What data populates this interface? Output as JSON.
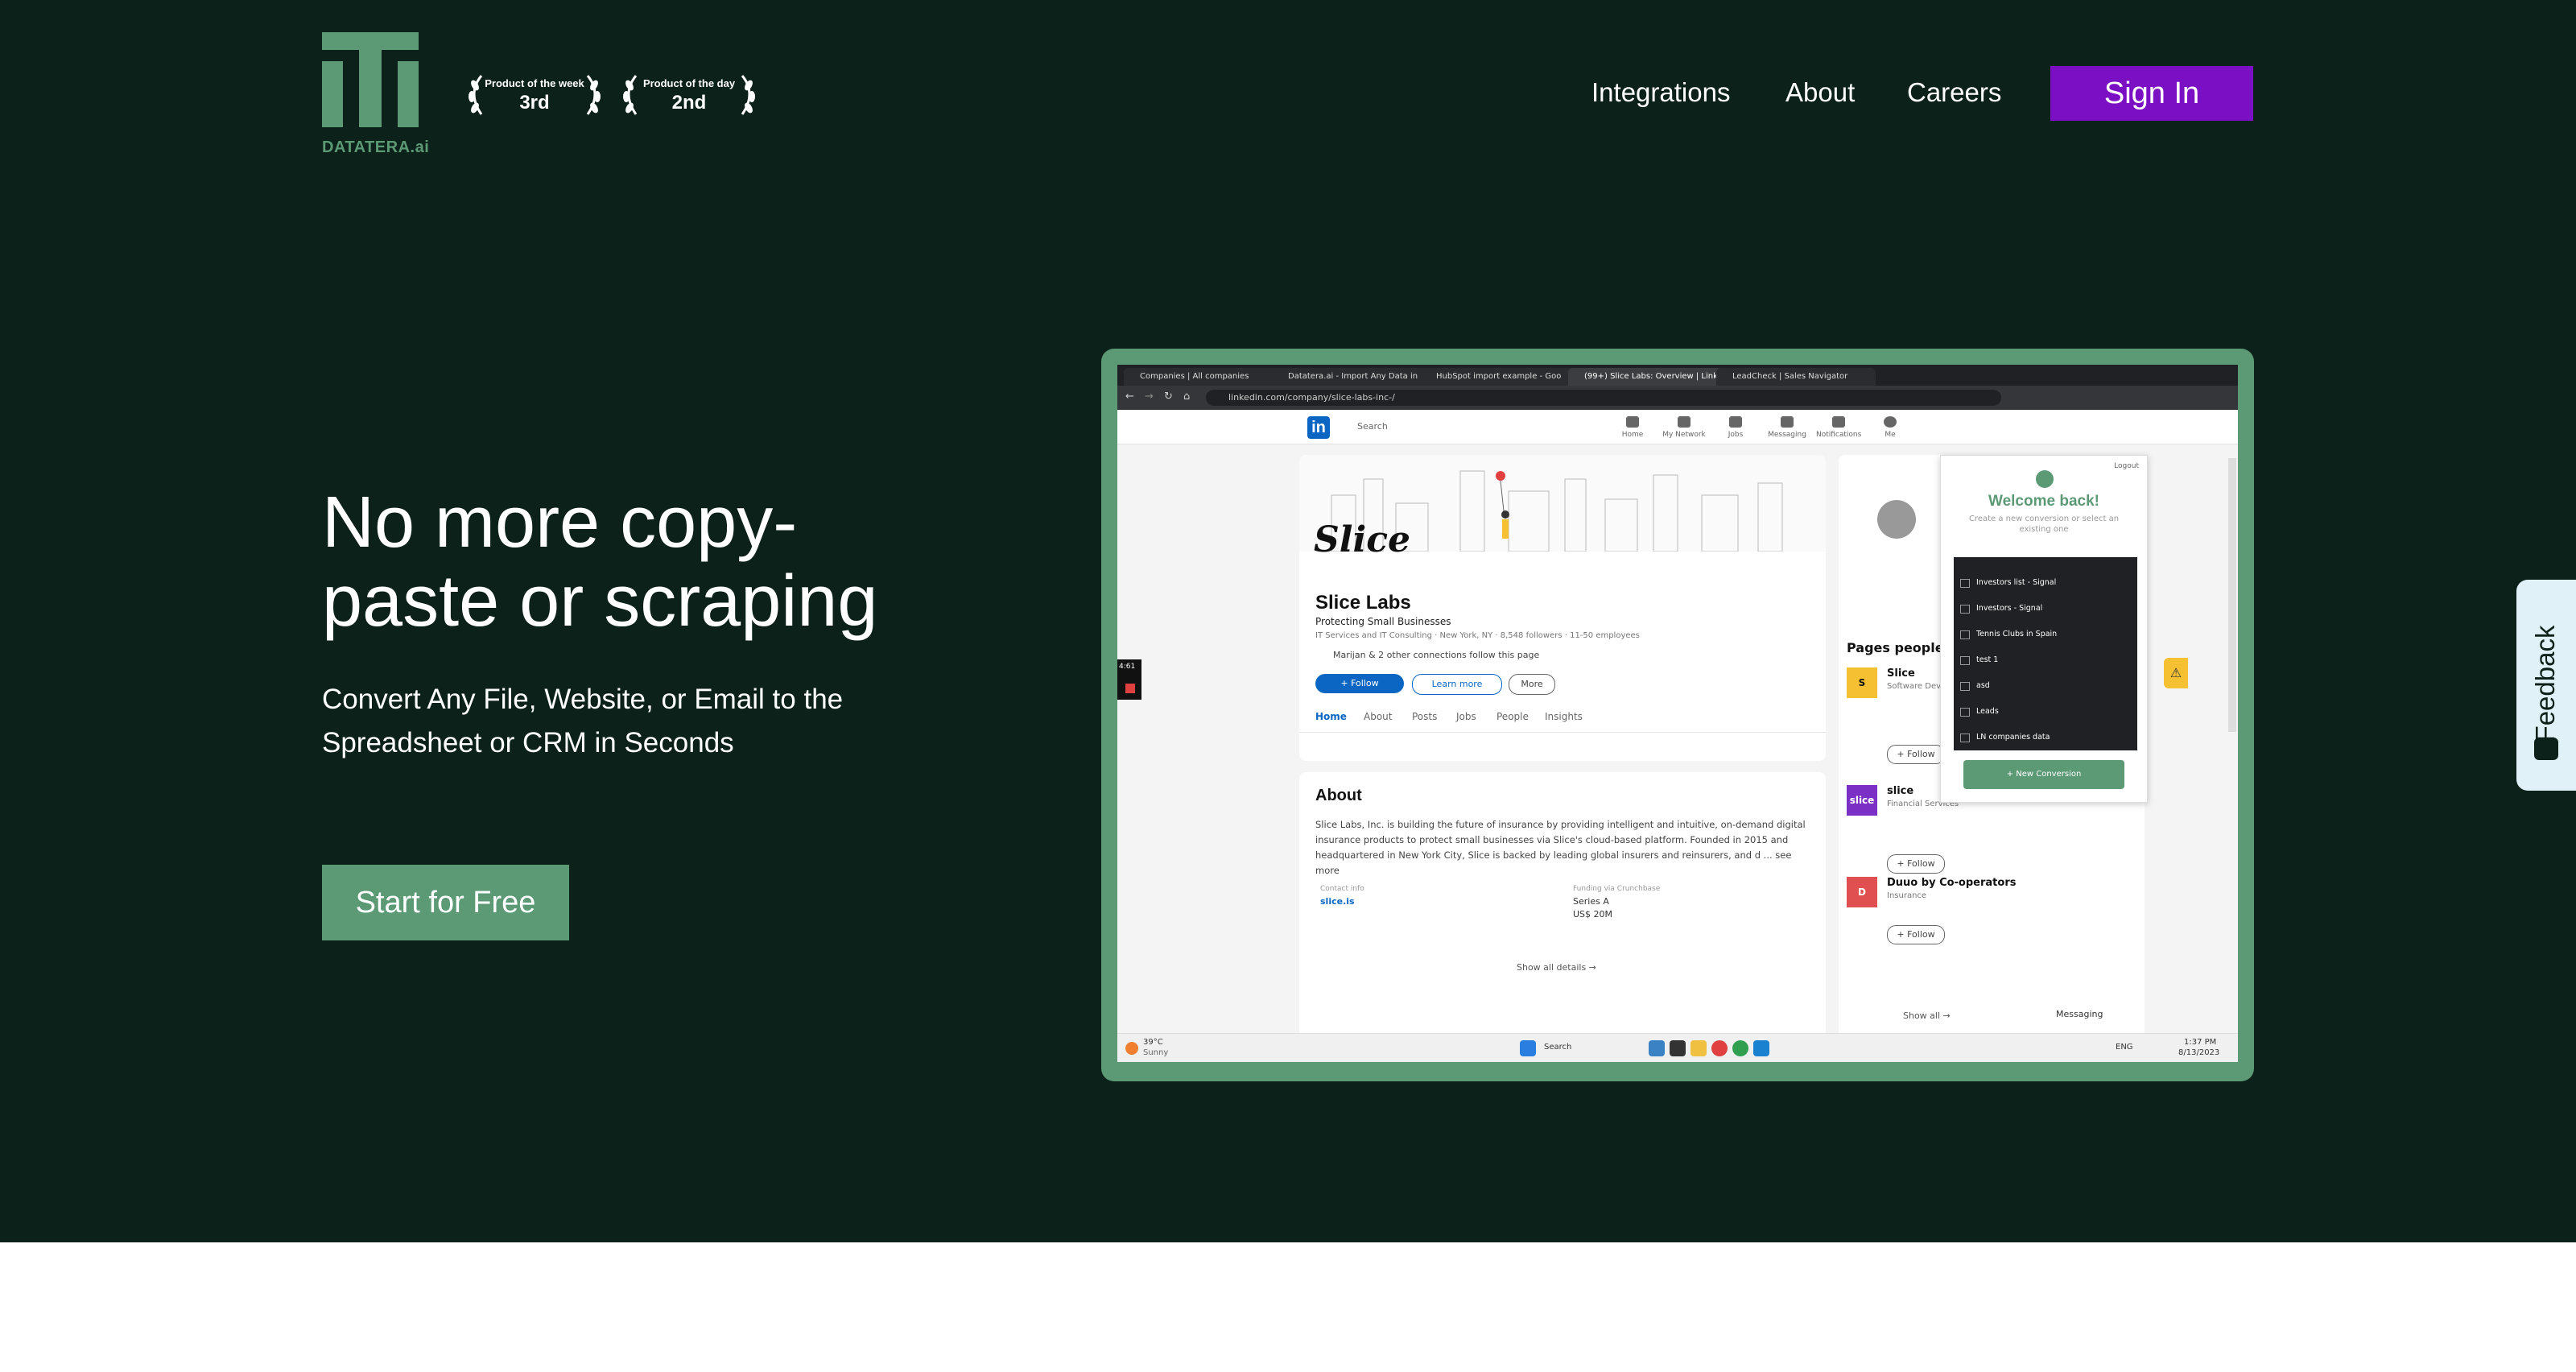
{
  "brand": {
    "name": "DATATERA.ai",
    "colors": {
      "background": "#0c2119",
      "accent_green": "#5c9a76",
      "signin_purple": "#7b0fc4",
      "feedback_bg": "#e0f1f8"
    }
  },
  "awards": [
    {
      "title": "Product of the week",
      "rank": "3rd"
    },
    {
      "title": "Product of the day",
      "rank": "2nd"
    }
  ],
  "nav": {
    "items": [
      "Integrations",
      "About",
      "Careers"
    ],
    "signin_label": "Sign In"
  },
  "hero": {
    "headline": "No more copy-paste or scraping",
    "subline": "Convert Any File, Website, or Email to the Spreadsheet or CRM in Seconds",
    "cta_label": "Start for Free"
  },
  "demo": {
    "browser_tabs": [
      "Companies | All companies",
      "Datatera.ai - Import Any Data in",
      "HubSpot import example - Goo",
      "(99+) Slice Labs: Overview | Link",
      "LeadCheck | Sales Navigator"
    ],
    "url": "linkedin.com/company/slice-labs-inc-/",
    "linkedin": {
      "search_placeholder": "Search",
      "nav": [
        "Home",
        "My Network",
        "Jobs",
        "Messaging",
        "Notifications",
        "Me"
      ],
      "logo_text": "Slice",
      "company_name": "Slice Labs",
      "tagline": "Protecting Small Businesses",
      "meta": "IT Services and IT Consulting · New York, NY · 8,548 followers · 11-50 employees",
      "connections": "Marijan & 2 other connections follow this page",
      "buttons": {
        "follow": "+ Follow",
        "learn_more": "Learn more",
        "more": "More"
      },
      "tabs": [
        "Home",
        "About",
        "Posts",
        "Jobs",
        "People",
        "Insights"
      ],
      "about_title": "About",
      "about_text": "Slice Labs, Inc. is building the future of insurance by providing intelligent and intuitive, on-demand digital insurance products to protect small businesses via Slice's cloud-based platform. Founded in 2015 and headquartered in New York City, Slice is backed by leading global insurers and reinsurers, and d ... see more",
      "contact_label": "Contact info",
      "contact_value": "slice.is",
      "funding_label": "Funding via Crunchbase",
      "funding_series": "Series A",
      "funding_amount": "US$ 20M",
      "show_all_details": "Show all details →",
      "pages_people_title": "Pages people also viewed",
      "pages_people": [
        {
          "name": "Slice",
          "sub": "Software Development"
        },
        {
          "name": "slice",
          "sub": "Financial Services"
        },
        {
          "name": "Duuo by Co-operators",
          "sub": "Insurance"
        }
      ],
      "follow_label": "+ Follow",
      "show_all": "Show all →",
      "messaging": "Messaging"
    },
    "extension": {
      "logout": "Logout",
      "title": "Welcome back!",
      "subtitle": "Create a new conversion or select an existing one",
      "items": [
        "Investors list - Signal",
        "Investors - Signal",
        "Tennis Clubs in Spain",
        "test 1",
        "asd",
        "Leads",
        "LN companies data"
      ],
      "new_conversion": "+ New Conversion"
    },
    "taskbar": {
      "weather_temp": "39°C",
      "weather_desc": "Sunny",
      "search": "Search",
      "lang": "ENG",
      "time": "1:37 PM",
      "date": "8/13/2023"
    },
    "recorder_time": "4:61"
  },
  "feedback_label": "Feedback"
}
